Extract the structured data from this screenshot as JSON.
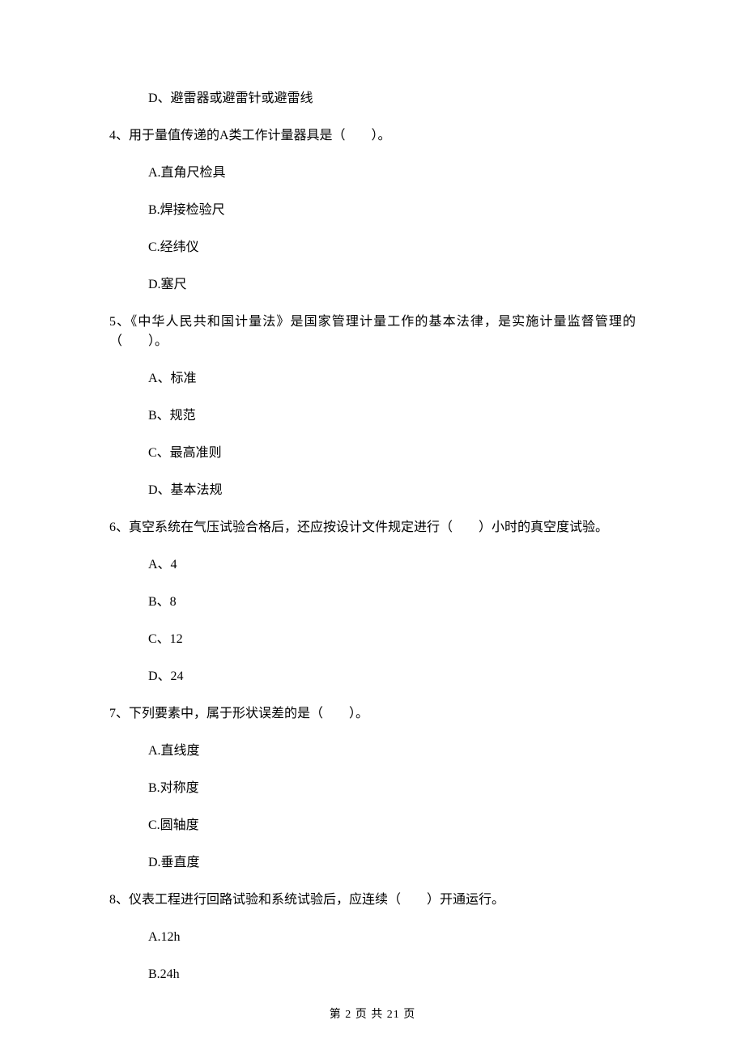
{
  "items": [
    {
      "type": "option",
      "text": "D、避雷器或避雷针或避雷线"
    },
    {
      "type": "question",
      "text": "4、用于量值传递的A类工作计量器具是（　　）。"
    },
    {
      "type": "option",
      "text": "A.直角尺检具"
    },
    {
      "type": "option",
      "text": "B.焊接检验尺"
    },
    {
      "type": "option",
      "text": "C.经纬仪"
    },
    {
      "type": "option",
      "text": "D.塞尺"
    },
    {
      "type": "question",
      "text": "5、《中华人民共和国计量法》是国家管理计量工作的基本法律，是实施计量监督管理的（　　）。"
    },
    {
      "type": "option",
      "text": "A、标准"
    },
    {
      "type": "option",
      "text": "B、规范"
    },
    {
      "type": "option",
      "text": "C、最高准则"
    },
    {
      "type": "option",
      "text": "D、基本法规"
    },
    {
      "type": "question",
      "text": "6、真空系统在气压试验合格后，还应按设计文件规定进行（　　）小时的真空度试验。"
    },
    {
      "type": "option",
      "text": "A、4"
    },
    {
      "type": "option",
      "text": "B、8"
    },
    {
      "type": "option",
      "text": "C、12"
    },
    {
      "type": "option",
      "text": "D、24"
    },
    {
      "type": "question",
      "text": "7、下列要素中，属于形状误差的是（　　）。"
    },
    {
      "type": "option",
      "text": "A.直线度"
    },
    {
      "type": "option",
      "text": "B.对称度"
    },
    {
      "type": "option",
      "text": "C.圆轴度"
    },
    {
      "type": "option",
      "text": "D.垂直度"
    },
    {
      "type": "question",
      "text": "8、仪表工程进行回路试验和系统试验后，应连续（　　）开通运行。"
    },
    {
      "type": "option",
      "text": "A.12h"
    },
    {
      "type": "option",
      "text": "B.24h"
    }
  ],
  "footer": "第 2 页 共 21 页"
}
